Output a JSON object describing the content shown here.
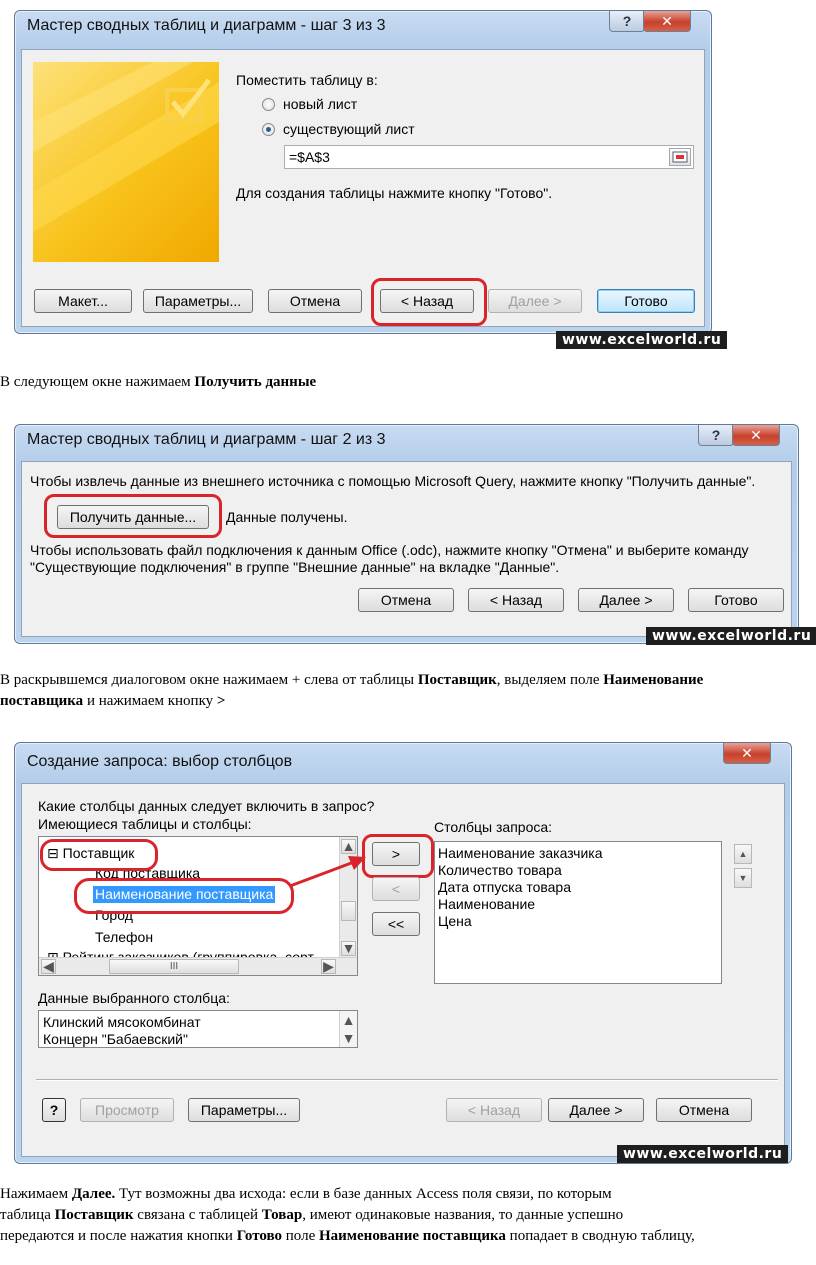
{
  "dialog1": {
    "title": "Мастер сводных таблиц и диаграмм - шаг 3 из 3",
    "help": "?",
    "close": "✕",
    "place_label": "Поместить таблицу в:",
    "radio_new": "новый лист",
    "radio_existing": "существующий лист",
    "location_value": "=$A$3",
    "hint": "Для создания таблицы нажмите кнопку \"Готово\".",
    "buttons": {
      "layout": "Макет...",
      "options": "Параметры...",
      "cancel": "Отмена",
      "back": "< Назад",
      "next": "Далее >",
      "finish": "Готово"
    },
    "watermark": "www.excelworld.ru"
  },
  "text1": {
    "plain": "В следующем окне нажимаем ",
    "bold": "Получить данные"
  },
  "dialog2": {
    "title": "Мастер сводных таблиц и диаграмм - шаг 2 из 3",
    "help": "?",
    "close": "✕",
    "line1": "Чтобы извлечь данные из внешнего источника с помощью Microsoft Query, нажмите кнопку \"Получить данные\".",
    "get_data_button": "Получить данные...",
    "data_received": "Данные получены.",
    "line2": "Чтобы использовать файл подключения к данным Office (.odc), нажмите кнопку \"Отмена\" и выберите команду",
    "line3": "\"Существующие подключения\" в группе \"Внешние данные\" на вкладке \"Данные\".",
    "buttons": {
      "cancel": "Отмена",
      "back": "< Назад",
      "next": "Далее >",
      "finish": "Готово"
    },
    "watermark": "www.excelworld.ru"
  },
  "text2": {
    "p1": "В раскрывшемся диалоговом окне нажимаем + слева от таблицы ",
    "b1": "Поставщик",
    "p2": ", выделяем поле ",
    "b2": "Наименование",
    "b3": "поставщика",
    "p3": " и нажимаем кнопку ",
    "b4": ">"
  },
  "dialog3": {
    "title": "Создание запроса: выбор столбцов",
    "close": "✕",
    "question": "Какие столбцы данных следует включить в запрос?",
    "available_label": "Имеющиеся таблицы и столбцы:",
    "tree": {
      "expander": "⊟",
      "table": "Поставщик",
      "items": [
        "Код поставщика",
        "Наименование поставщика",
        "Город",
        "Телефон"
      ],
      "next_expander": "⊞",
      "next_table": "Рейтинг заказчиков (группировка, сорт"
    },
    "hscroll_thumb": "III",
    "move_buttons": [
      ">",
      "<",
      "<<"
    ],
    "query_columns_label": "Столбцы запроса:",
    "query_columns": [
      "Наименование заказчика",
      "Количество товара",
      "Дата отпуска товара",
      "Наименование",
      "Цена"
    ],
    "selected_data_label": "Данные выбранного столбца:",
    "selected_data": [
      "Клинский мясокомбинат",
      "Концерн \"Бабаевский\""
    ],
    "help_button": "?",
    "buttons": {
      "preview": "Просмотр",
      "options": "Параметры...",
      "back": "< Назад",
      "next": "Далее >",
      "cancel": "Отмена"
    },
    "watermark": "www.excelworld.ru"
  },
  "text3": {
    "l1_bold": "Далее.",
    "l1_pre": "Нажимаем ",
    "l1_post": " Тут возможны два исхода: если в базе данных Access поля связи, по которым",
    "l2_pre": "таблица ",
    "l2_b1": "Поставщик",
    "l2_mid": " связана с таблицей ",
    "l2_b2": "Товар",
    "l2_post": ", имеют одинаковые названия, то данные успешно",
    "l3_pre": "передаются и после нажатия кнопки ",
    "l3_b1": "Готово",
    "l3_mid": " поле ",
    "l3_b2": "Наименование поставщика",
    "l3_post": " попадает в сводную таблицу,"
  },
  "colors": {
    "highlight_ring": "#d9242b",
    "selection": "#3399ff",
    "titlebar": "#bcd3ec"
  }
}
